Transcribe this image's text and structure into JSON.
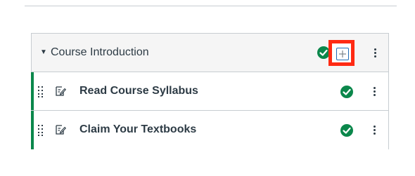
{
  "module": {
    "title": "Course Introduction",
    "items": [
      {
        "title": "Read Course Syllabus",
        "status": "published"
      },
      {
        "title": "Claim Your Textbooks",
        "status": "published"
      }
    ]
  },
  "icons": {
    "collapse": "caret-down-icon",
    "published": "check-circle-icon",
    "add": "plus-icon",
    "more": "kebab-icon",
    "drag": "drag-handle-icon",
    "page": "page-edit-icon"
  },
  "colors": {
    "published_green": "#0b874b",
    "highlight_red": "#ff2a13",
    "add_button_border": "#1f6bb5"
  }
}
